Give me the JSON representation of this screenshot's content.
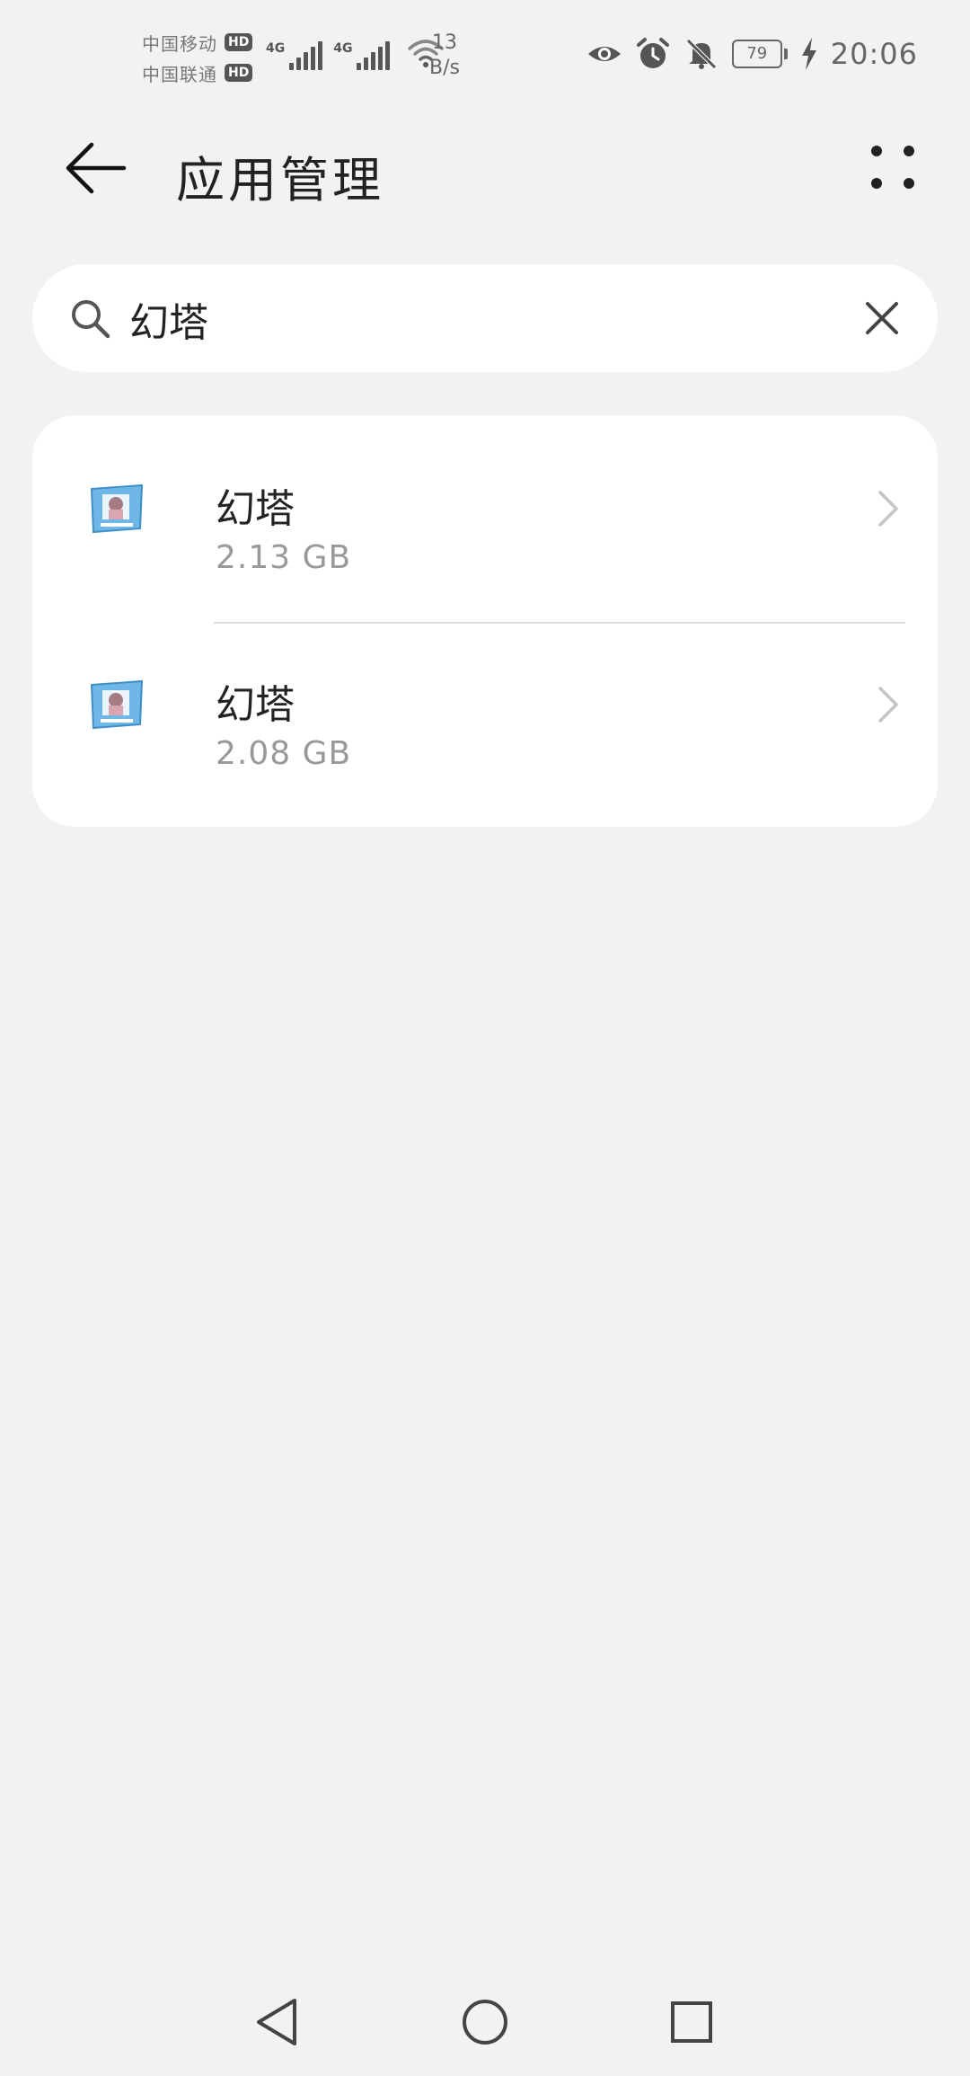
{
  "status_bar": {
    "carriers": [
      {
        "name": "中国移动",
        "badge": "HD"
      },
      {
        "name": "中国联通",
        "badge": "HD"
      }
    ],
    "signal_labels": [
      "4G",
      "4G"
    ],
    "net_speed_value": "13",
    "net_speed_unit": "B/s",
    "battery": "79",
    "clock": "20:06",
    "icons": [
      "eye-icon",
      "alarm-icon",
      "bell-muted-icon",
      "battery-icon",
      "charging-icon"
    ]
  },
  "header": {
    "title": "应用管理",
    "back_icon": "arrow-left-icon",
    "more_icon": "more-dots-icon"
  },
  "search": {
    "value": "幻塔",
    "placeholder": "",
    "search_icon": "search-icon",
    "clear_icon": "close-icon"
  },
  "apps": [
    {
      "name": "幻塔",
      "size": "2.13 GB"
    },
    {
      "name": "幻塔",
      "size": "2.08 GB"
    }
  ],
  "nav_bar": {
    "icons": [
      "nav-back-icon",
      "nav-home-icon",
      "nav-recent-icon"
    ]
  },
  "colors": {
    "background": "#f1f2f4",
    "card": "#ffffff",
    "text_primary": "#222222",
    "text_secondary": "#999999",
    "app_icon_accent": "#6fb7e6"
  }
}
